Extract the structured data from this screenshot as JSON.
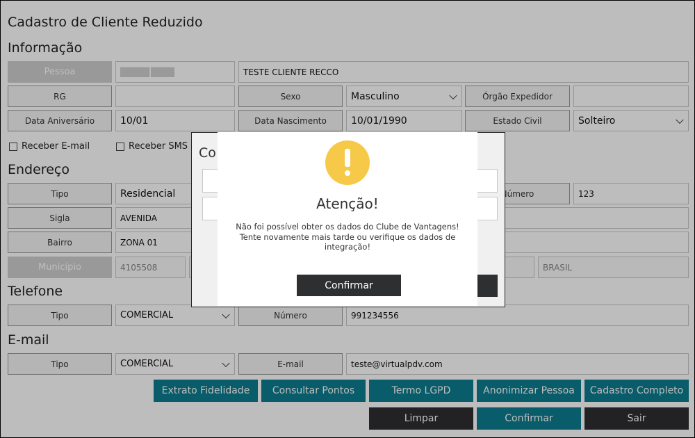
{
  "page_title": "Cadastro de Cliente Reduzido",
  "info": {
    "section_title": "Informação",
    "pessoa_label": "Pessoa",
    "pessoa_code": "█████ ████",
    "nome_value": "TESTE CLIENTE RECCO",
    "rg_label": "RG",
    "rg_value": "",
    "sexo_label": "Sexo",
    "sexo_value": "Masculino",
    "orgao_label": "Órgão Expedidor",
    "orgao_value": "",
    "aniversario_label": "Data Aniversário",
    "aniversario_value": "10/01",
    "nascimento_label": "Data Nascimento",
    "nascimento_value": "10/01/1990",
    "estado_civil_label": "Estado Civil",
    "estado_civil_value": "Solteiro",
    "receber_email": "Receber E-mail",
    "receber_sms": "Receber SMS"
  },
  "endereco": {
    "section_title": "Endereço",
    "tipo_label": "Tipo",
    "tipo_value": "Residencial",
    "numero_label": "Número",
    "numero_value": "123",
    "sigla_label": "Sigla",
    "sigla_value": "AVENIDA",
    "bairro_label": "Bairro",
    "bairro_value": "ZONA 01",
    "municipio_label": "Município",
    "municipio_code": "4105508",
    "pais_value": "BRASIL"
  },
  "telefone": {
    "section_title": "Telefone",
    "tipo_label": "Tipo",
    "tipo_value": "COMERCIAL",
    "numero_label": "Número",
    "numero_value": "991234556"
  },
  "email": {
    "section_title": "E-mail",
    "tipo_label": "Tipo",
    "tipo_value": "COMERCIAL",
    "email_label": "E-mail",
    "email_value": "teste@virtualpdv.com"
  },
  "actions": {
    "extrato": "Extrato Fidelidade",
    "consultar": "Consultar Pontos",
    "termo": "Termo LGPD",
    "anonimizar": "Anonimizar Pessoa",
    "cadastro": "Cadastro Completo",
    "limpar": "Limpar",
    "confirmar": "Confirmar",
    "sair": "Sair"
  },
  "underlying_dialog": {
    "title_fragment": "Co"
  },
  "alert": {
    "icon": "warning-icon",
    "title": "Atenção!",
    "message_line1": "Não foi possível obter os dados do Clube de Vantagens!",
    "message_line2": "Tente novamente mais tarde ou verifique os dados de integração!",
    "confirm": "Confirmar"
  },
  "colors": {
    "teal": "#0d7d8f",
    "dark": "#2e2f31",
    "warning": "#f7c948"
  }
}
